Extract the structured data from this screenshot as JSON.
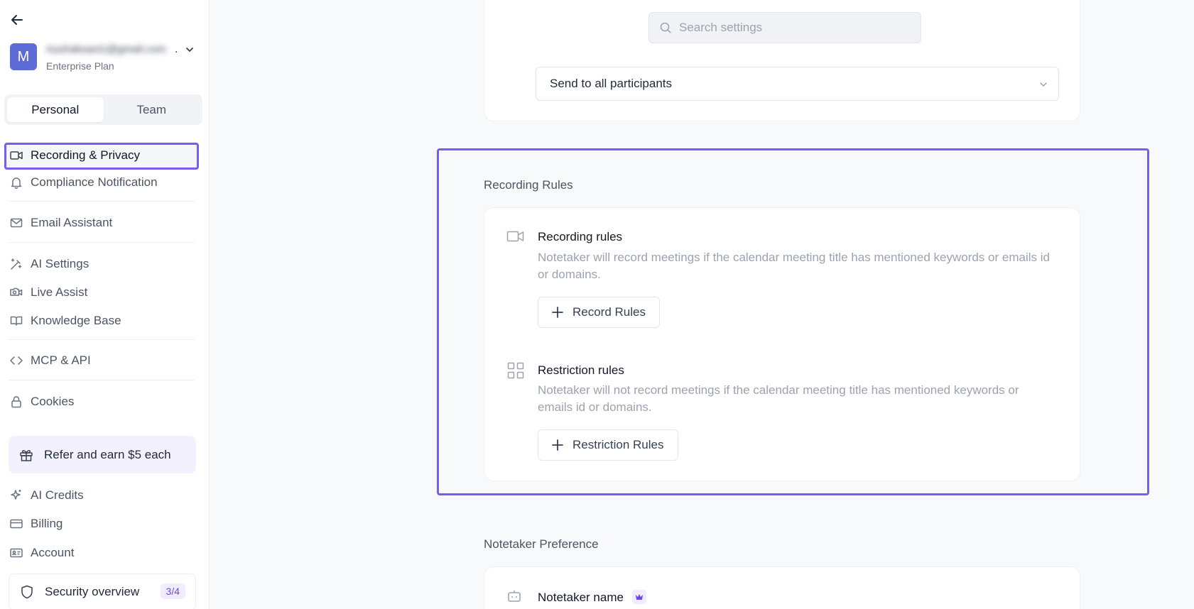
{
  "user": {
    "avatar_letter": "M",
    "email_masked": "riuuhaksani1@gmail.com",
    "email_ellipsis": ".",
    "plan": "Enterprise Plan"
  },
  "tabs": [
    {
      "label": "Personal",
      "active": true
    },
    {
      "label": "Team",
      "active": false
    }
  ],
  "sidebar": {
    "items": [
      {
        "label": "Recording & Privacy",
        "icon": "video-icon",
        "active": true
      },
      {
        "label": "Compliance Notification",
        "icon": "bell-icon"
      },
      {
        "label": "Email Assistant",
        "icon": "mail-icon"
      },
      {
        "label": "AI Settings",
        "icon": "magic-wand-icon"
      },
      {
        "label": "Live Assist",
        "icon": "live-camera-icon"
      },
      {
        "label": "Knowledge Base",
        "icon": "book-icon"
      },
      {
        "label": "MCP & API",
        "icon": "code-icon"
      },
      {
        "label": "Cookies",
        "icon": "lock-icon"
      },
      {
        "label": "AI Credits",
        "icon": "sparkle-icon"
      },
      {
        "label": "Billing",
        "icon": "credit-card-icon"
      },
      {
        "label": "Account",
        "icon": "id-card-icon"
      }
    ],
    "refer": {
      "label": "Refer and earn $5 each",
      "icon": "gift-icon"
    },
    "security": {
      "label": "Security overview",
      "badge": "3/4",
      "icon": "shield-icon"
    }
  },
  "search": {
    "placeholder": "Search settings"
  },
  "top_card": {
    "select_value": "Send to all participants"
  },
  "recording_rules": {
    "section_title": "Recording Rules",
    "rules": [
      {
        "title": "Recording rules",
        "description": "Notetaker will record meetings if the calendar meeting title has mentioned keywords or emails id or domains.",
        "button": "Record Rules",
        "icon": "video-icon"
      },
      {
        "title": "Restriction rules",
        "description": "Notetaker will not record meetings if the calendar meeting title has mentioned keywords or emails id or domains.",
        "button": "Restriction Rules",
        "icon": "grid-icon"
      }
    ]
  },
  "notetaker_preference": {
    "section_title": "Notetaker Preference",
    "name_label": "Notetaker name",
    "icon": "bot-icon"
  },
  "colors": {
    "accent": "#7a5cf0",
    "avatar": "#5e6bd6"
  }
}
